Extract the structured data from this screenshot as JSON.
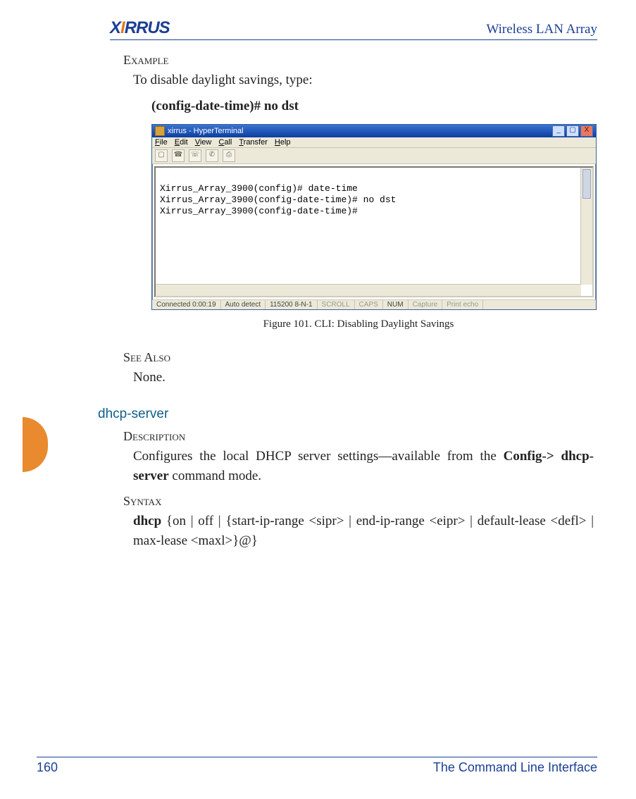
{
  "header": {
    "logo_pre": "X",
    "logo_accent": "I",
    "logo_post": "RRUS",
    "product": "Wireless LAN Array"
  },
  "example": {
    "heading": "Example",
    "intro": "To disable daylight savings, type:",
    "command": "(config-date-time)# no dst"
  },
  "hyperterminal": {
    "title": "xirrus - HyperTerminal",
    "menu": [
      "File",
      "Edit",
      "View",
      "Call",
      "Transfer",
      "Help"
    ],
    "terminal_lines": [
      "",
      "Xirrus_Array_3900(config)# date-time",
      "Xirrus_Array_3900(config-date-time)# no dst",
      "Xirrus_Array_3900(config-date-time)#"
    ],
    "status": {
      "conn": "Connected 0:00:19",
      "detect": "Auto detect",
      "port": "115200 8-N-1",
      "scroll": "SCROLL",
      "caps": "CAPS",
      "num": "NUM",
      "capture": "Capture",
      "echo": "Print echo"
    }
  },
  "figure_caption": "Figure 101. CLI: Disabling Daylight Savings",
  "see_also": {
    "heading": "See Also",
    "body": "None."
  },
  "dhcp": {
    "title": "dhcp-server",
    "desc_heading": "Description",
    "desc_pre": "Configures the local DHCP server settings—available from the ",
    "desc_bold": "Config-> dhcp-server",
    "desc_post": "  command mode.",
    "syntax_heading": "Syntax",
    "syntax_bold": "dhcp",
    "syntax_rest": " {on  |  off  |  {start-ip-range <sipr>  |  end-ip-range <eipr>  |  default-lease <defl>  | max-lease <maxl>}@}"
  },
  "footer": {
    "page": "160",
    "section": "The Command Line Interface"
  }
}
